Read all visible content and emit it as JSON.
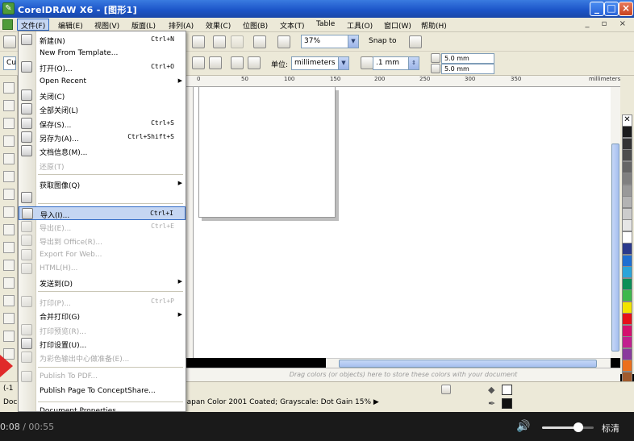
{
  "window": {
    "title": "CorelDRAW X6 - [图形1]",
    "buttons": [
      "_",
      "□",
      "×"
    ]
  },
  "menubar": {
    "items": [
      "文件(F)",
      "编辑(E)",
      "视图(V)",
      "版面(L)",
      "排列(A)",
      "效果(C)",
      "位图(B)",
      "文本(T)",
      "Table",
      "工具(O)",
      "窗口(W)",
      "帮助(H)"
    ],
    "mdi": "_ ▫ ×"
  },
  "toolbar": {
    "zoom": "37%",
    "snap_to": "Snap to",
    "units_label": "单位:",
    "units": "millimeters",
    "nudge": ".1 mm",
    "dup_x": "5.0 mm",
    "dup_y": "5.0 mm",
    "left_combo": "Cu"
  },
  "ruler": {
    "ticks": [
      "0",
      "50",
      "100",
      "150",
      "200",
      "250",
      "300",
      "350"
    ],
    "unit": "millimeters"
  },
  "file_menu": {
    "items": [
      {
        "label": "新建(N)",
        "shortcut": "Ctrl+N",
        "disabled": false,
        "icon": "new-document-icon"
      },
      {
        "label": "New From Template...",
        "shortcut": "",
        "disabled": false,
        "icon": ""
      },
      {
        "label": "打开(O)...",
        "shortcut": "Ctrl+O",
        "disabled": false,
        "icon": "open-folder-icon"
      },
      {
        "label": "Open Recent",
        "shortcut": "",
        "disabled": false,
        "submenu": true,
        "icon": ""
      },
      {
        "label": "关闭(C)",
        "shortcut": "",
        "disabled": false,
        "icon": "close-document-icon"
      },
      {
        "label": "全部关闭(L)",
        "shortcut": "",
        "disabled": false,
        "icon": "close-all-icon"
      },
      {
        "label": "保存(S)...",
        "shortcut": "Ctrl+S",
        "disabled": false,
        "icon": "save-icon"
      },
      {
        "label": "另存为(A)...",
        "shortcut": "Ctrl+Shift+S",
        "disabled": false,
        "icon": "save-as-icon"
      },
      {
        "label": "文档信息(M)...",
        "shortcut": "",
        "disabled": false,
        "icon": "document-info-icon"
      },
      {
        "label": "还原(T)",
        "shortcut": "",
        "disabled": true,
        "icon": ""
      },
      {
        "label": "获取图像(Q)",
        "shortcut": "",
        "disabled": false,
        "submenu": true,
        "icon": ""
      },
      {
        "label": "",
        "shortcut": "",
        "disabled": false,
        "icon": "scan-icon"
      },
      {
        "label": "导入(I)...",
        "shortcut": "Ctrl+I",
        "disabled": false,
        "icon": "import-icon",
        "highlighted": true
      },
      {
        "label": "导出(E)...",
        "shortcut": "Ctrl+E",
        "disabled": true,
        "icon": "export-icon"
      },
      {
        "label": "导出到 Office(R)...",
        "shortcut": "",
        "disabled": true,
        "icon": "export-office-icon"
      },
      {
        "label": "Export For Web...",
        "shortcut": "",
        "disabled": true,
        "icon": "export-web-icon"
      },
      {
        "label": "HTML(H)...",
        "shortcut": "",
        "disabled": true,
        "icon": "html-icon"
      },
      {
        "label": "发送到(D)",
        "shortcut": "",
        "disabled": false,
        "submenu": true,
        "icon": ""
      },
      {
        "label": "打印(P)...",
        "shortcut": "Ctrl+P",
        "disabled": true,
        "icon": "print-icon"
      },
      {
        "label": "合并打印(G)",
        "shortcut": "",
        "disabled": false,
        "submenu": true,
        "icon": ""
      },
      {
        "label": "打印预览(R)...",
        "shortcut": "",
        "disabled": true,
        "icon": "print-preview-icon"
      },
      {
        "label": "打印设置(U)...",
        "shortcut": "",
        "disabled": false,
        "icon": "print-setup-icon"
      },
      {
        "label": "为彩色输出中心做准备(E)...",
        "shortcut": "",
        "disabled": true,
        "icon": "prepare-output-icon"
      },
      {
        "label": "Publish To PDF...",
        "shortcut": "",
        "disabled": true,
        "icon": "pdf-icon"
      },
      {
        "label": "Publish Page To ConceptShare...",
        "shortcut": "",
        "disabled": false,
        "icon": ""
      },
      {
        "label": "Document Properties...",
        "shortcut": "",
        "disabled": false,
        "icon": ""
      }
    ]
  },
  "colorbar_hint": "Drag colors (or objects) here to store these colors with your document",
  "status": {
    "coords": "(-1",
    "doc": "Doc",
    "profile": "Japan Color 2001 Coated; Grayscale: Dot Gain 15% ▶"
  },
  "palette_colors": [
    "#ffffff",
    "#1a1a1a",
    "#333333",
    "#4d4d4d",
    "#666666",
    "#808080",
    "#999999",
    "#b3b3b3",
    "#cccccc",
    "#e6e6e6",
    "#ffffff",
    "#2b3a8c",
    "#1f6fd1",
    "#2aa4d8",
    "#0a8f57",
    "#3db84a",
    "#f2e300",
    "#e6101a",
    "#d4116e",
    "#c21f8e",
    "#8a3b9c",
    "#ec6f1a",
    "#a05a2c",
    "#7a4a2a"
  ],
  "player": {
    "current": "0:08",
    "total": "00:55",
    "volume": 0.7,
    "quality": "标清"
  }
}
